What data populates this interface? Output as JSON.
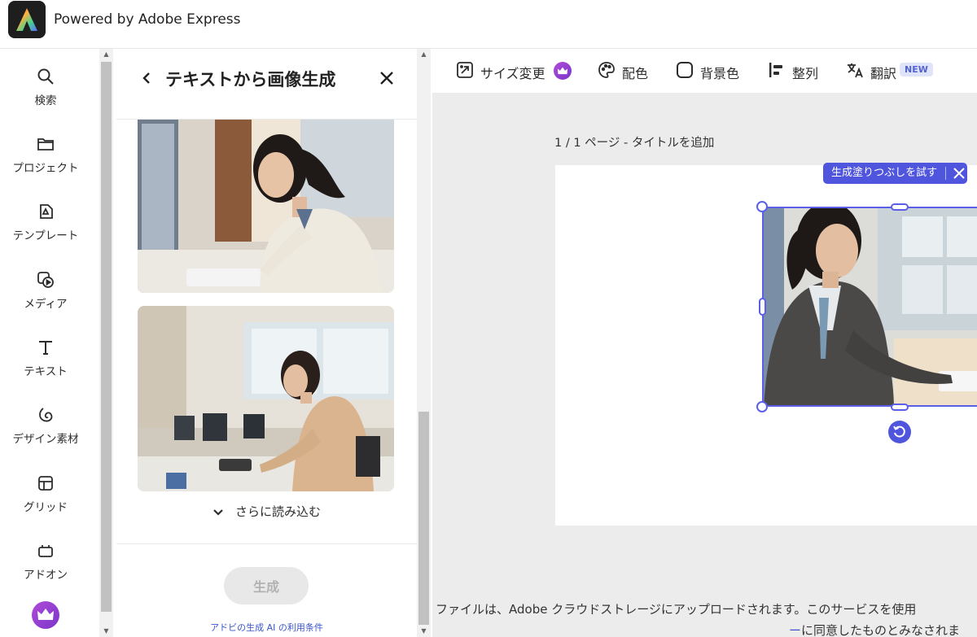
{
  "header": {
    "brand": "Powered by Adobe Express",
    "logo_icon": "adobe-express-logo"
  },
  "sidebar": {
    "items": [
      {
        "label": "検索",
        "icon": "search-icon"
      },
      {
        "label": "プロジェクト",
        "icon": "folder-icon"
      },
      {
        "label": "テンプレート",
        "icon": "template-icon"
      },
      {
        "label": "メディア",
        "icon": "media-icon"
      },
      {
        "label": "テキスト",
        "icon": "text-icon"
      },
      {
        "label": "デザイン素材",
        "icon": "shapes-icon"
      },
      {
        "label": "グリッド",
        "icon": "grid-icon"
      },
      {
        "label": "アドオン",
        "icon": "addon-icon"
      }
    ],
    "premium_icon": "crown-icon"
  },
  "panel": {
    "title": "テキストから画像生成",
    "load_more": "さらに読み込む",
    "generate_label": "生成",
    "terms_link": "アドビの生成 AI の利用条件"
  },
  "toolbar": {
    "items": [
      {
        "label": "サイズ変更",
        "icon": "resize-icon",
        "premium": true
      },
      {
        "label": "配色",
        "icon": "palette-icon"
      },
      {
        "label": "背景色",
        "icon": "background-color-icon"
      },
      {
        "label": "整列",
        "icon": "align-icon"
      },
      {
        "label": "翻訳",
        "icon": "translate-icon",
        "badge": "NEW"
      }
    ]
  },
  "canvas": {
    "page_label": "1 / 1 ページ - タイトルを追加",
    "generative_fill_chip": "生成塗りつぶしを試す",
    "notice_line1": "ファイルは、Adobe クラウドストレージにアップロードされます。このサービスを使用",
    "notice_link_fragment": "ー",
    "notice_line2": "に同意したものとみなされま"
  },
  "colors": {
    "accent": "#4f55dd",
    "premium": "#9b3fd3",
    "link": "#3a55c9"
  }
}
